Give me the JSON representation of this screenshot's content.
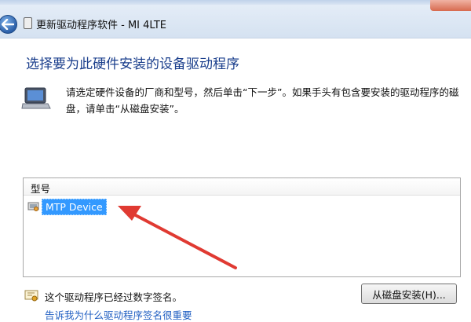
{
  "window": {
    "title": "更新驱动程序软件 - MI 4LTE"
  },
  "main": {
    "heading": "选择要为此硬件安装的设备驱动程序",
    "instructions": "请选定硬件设备的厂商和型号，然后单击“下一步”。如果手头有包含要安装的驱动程序的磁盘，请单击“从磁盘安装”。"
  },
  "list": {
    "header": "型号",
    "items": [
      {
        "label": "MTP Device",
        "selected": true
      }
    ]
  },
  "footer": {
    "signed_text": "这个驱动程序已经过数字签名。",
    "disk_button": "从磁盘安装(H)...",
    "link_text": "告诉我为什么驱动程序签名很重要"
  },
  "colors": {
    "heading": "#1a3e8c",
    "selection": "#3399ff",
    "annotation_arrow": "#e03a32",
    "link": "#1f5ec2"
  },
  "icons": [
    "back-arrow-icon",
    "device-icon",
    "laptop-icon",
    "driver-icon",
    "certificate-icon"
  ]
}
